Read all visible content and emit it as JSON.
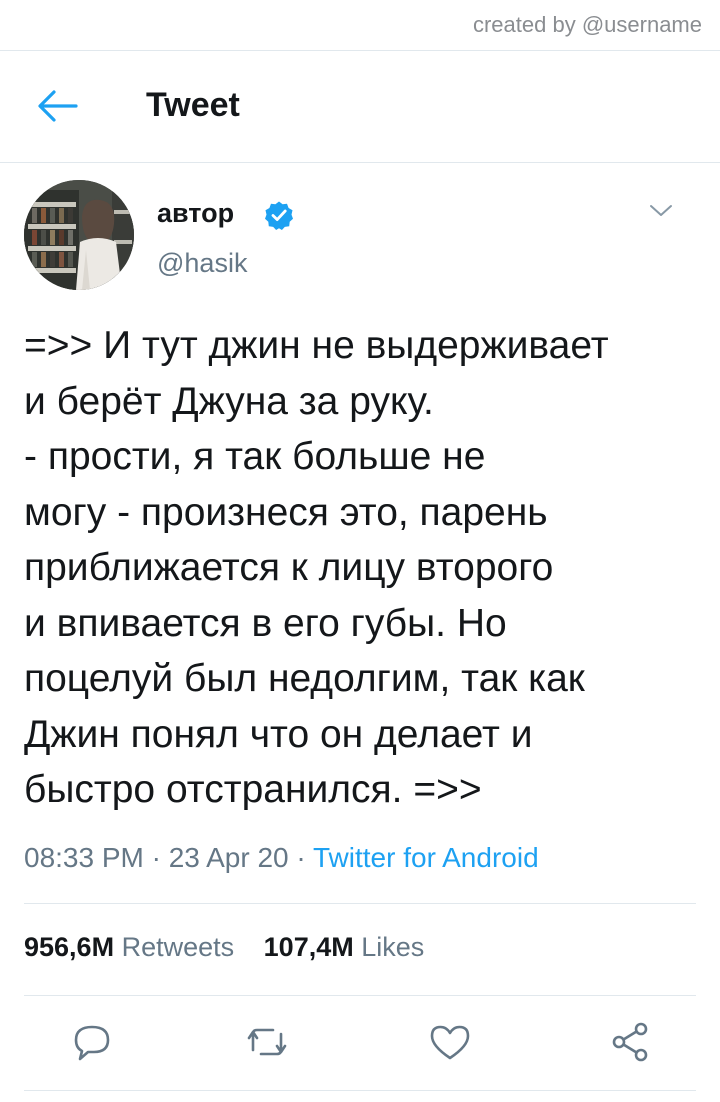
{
  "watermark": "created by @username",
  "header": {
    "title": "Tweet",
    "back_icon": "arrow-left-icon"
  },
  "author": {
    "name": "автор",
    "handle": "@hasik",
    "verified_icon": "verified-badge-icon",
    "menu_icon": "chevron-down-icon"
  },
  "tweet": {
    "text": "=>> И тут джин не выдерживает\nи берёт Джуна за руку.\n- прости, я так больше не\nмогу - произнеся это, парень\nприближается к лицу второго\nи впивается в его губы. Но\nпоцелуй был недолгим, так как\nДжин понял что он делает и\nбыстро отстранился. =>>",
    "time": "08:33 PM · 23 Apr 20 · ",
    "source": "Twitter for Android"
  },
  "stats": {
    "retweets_count": "956,6M",
    "retweets_label": "Retweets",
    "likes_count": "107,4M",
    "likes_label": "Likes"
  },
  "actions": [
    {
      "icon": "reply-icon"
    },
    {
      "icon": "retweet-icon"
    },
    {
      "icon": "like-icon"
    },
    {
      "icon": "share-icon"
    }
  ],
  "colors": {
    "accent": "#1da1f2",
    "secondary_text": "#657786",
    "primary_text": "#14171a",
    "divider": "#e1e8ed"
  }
}
